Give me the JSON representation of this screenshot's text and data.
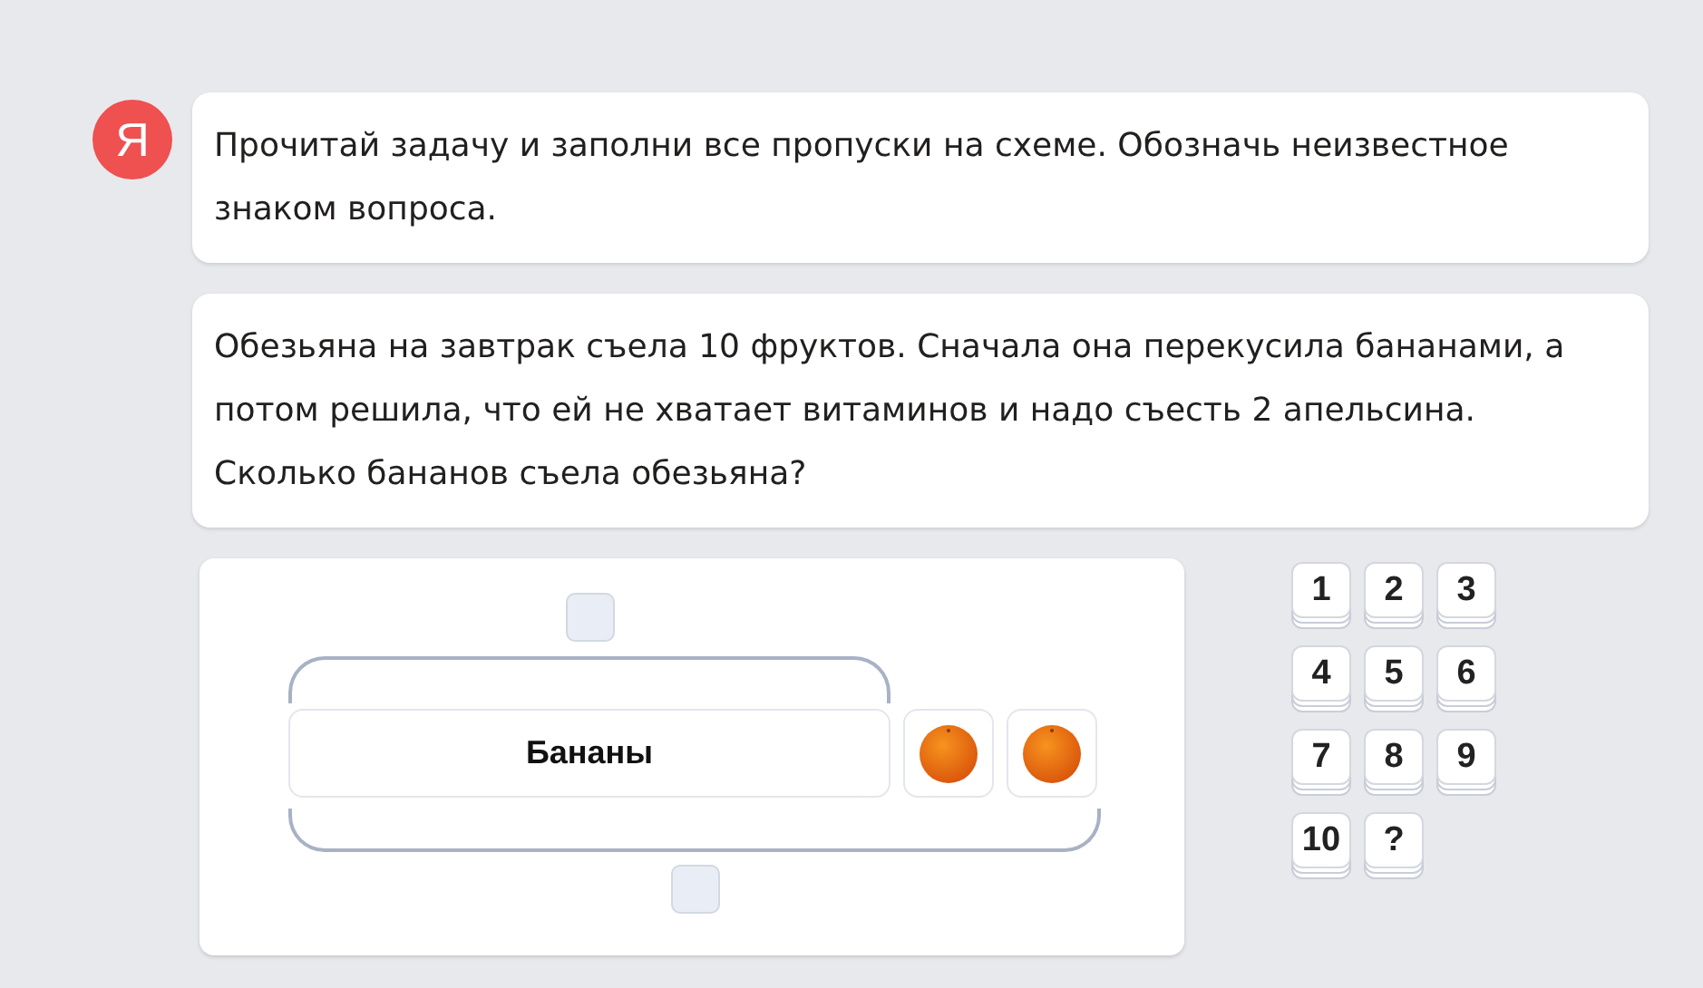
{
  "avatar": {
    "letter": "Я"
  },
  "instruction": "Прочитай задачу и заполни все пропуски на схеме. Обозначь неизвестное знаком вопроса.",
  "problem": "Обезьяна на завтрак съела 10 фруктов. Сначала она перекусила бананами, а потом решила, что ей не хватает витаминов и надо съесть 2 апельсина. Сколько бананов съела обезьяна?",
  "scheme": {
    "parts": [
      {
        "kind": "label",
        "text": "Бананы"
      },
      {
        "kind": "orange"
      },
      {
        "kind": "orange"
      }
    ]
  },
  "answer_tiles": [
    "1",
    "2",
    "3",
    "4",
    "5",
    "6",
    "7",
    "8",
    "9",
    "10",
    "?"
  ]
}
